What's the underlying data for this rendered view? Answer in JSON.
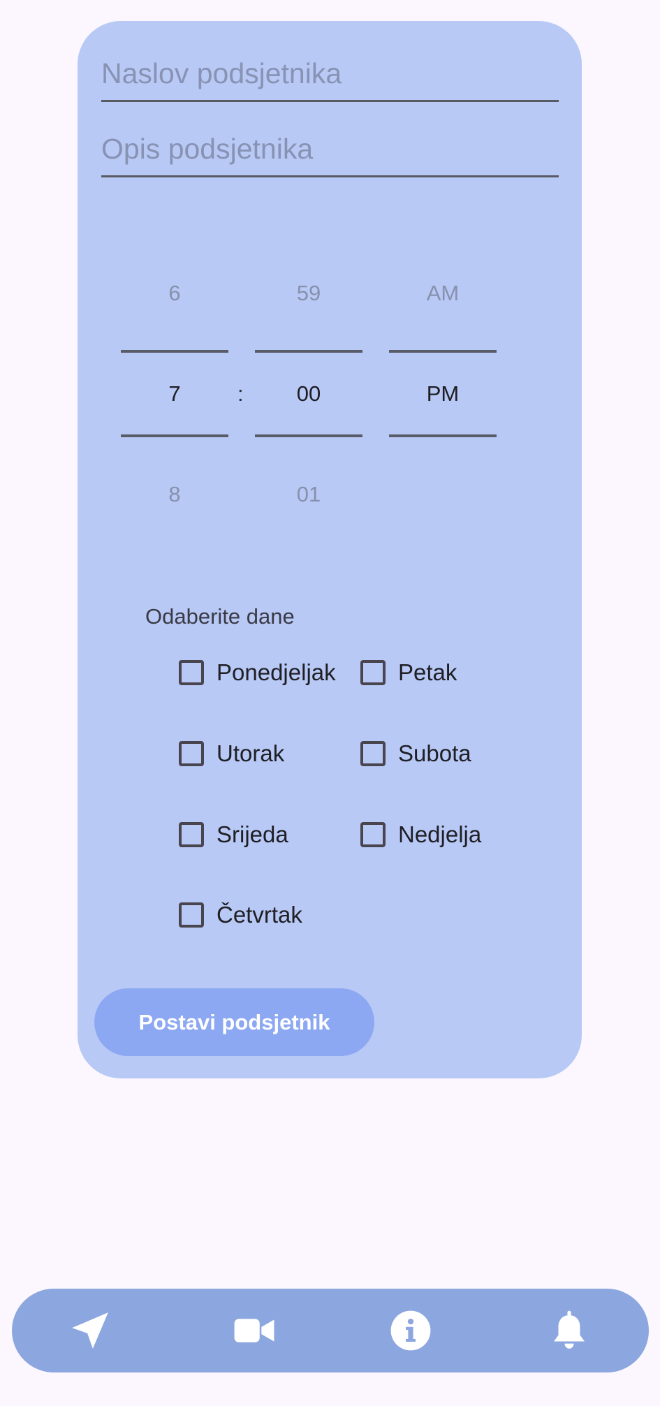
{
  "form": {
    "title_placeholder": "Naslov podsjetnika",
    "description_placeholder": "Opis podsjetnika"
  },
  "time_picker": {
    "hour": {
      "prev": "6",
      "current": "7",
      "next": "8"
    },
    "minute": {
      "prev": "59",
      "current": "00",
      "next": "01"
    },
    "period": {
      "prev": "AM",
      "current": "PM",
      "next": ""
    },
    "separator": ":"
  },
  "days": {
    "label": "Odaberite dane",
    "items": [
      {
        "label": "Ponedjeljak",
        "checked": false
      },
      {
        "label": "Utorak",
        "checked": false
      },
      {
        "label": "Srijeda",
        "checked": false
      },
      {
        "label": "Četvrtak",
        "checked": false
      },
      {
        "label": "Petak",
        "checked": false
      },
      {
        "label": "Subota",
        "checked": false
      },
      {
        "label": "Nedjelja",
        "checked": false
      }
    ]
  },
  "submit_label": "Postavi podsjetnik",
  "nav": {
    "items": [
      {
        "icon": "navigation-arrow-icon"
      },
      {
        "icon": "video-camera-icon"
      },
      {
        "icon": "info-icon"
      },
      {
        "icon": "bell-icon"
      }
    ]
  },
  "colors": {
    "background": "#FCF7FE",
    "card": "#B8C9F6",
    "button": "#8CA8F2",
    "nav_bar": "#8CA7DF"
  }
}
